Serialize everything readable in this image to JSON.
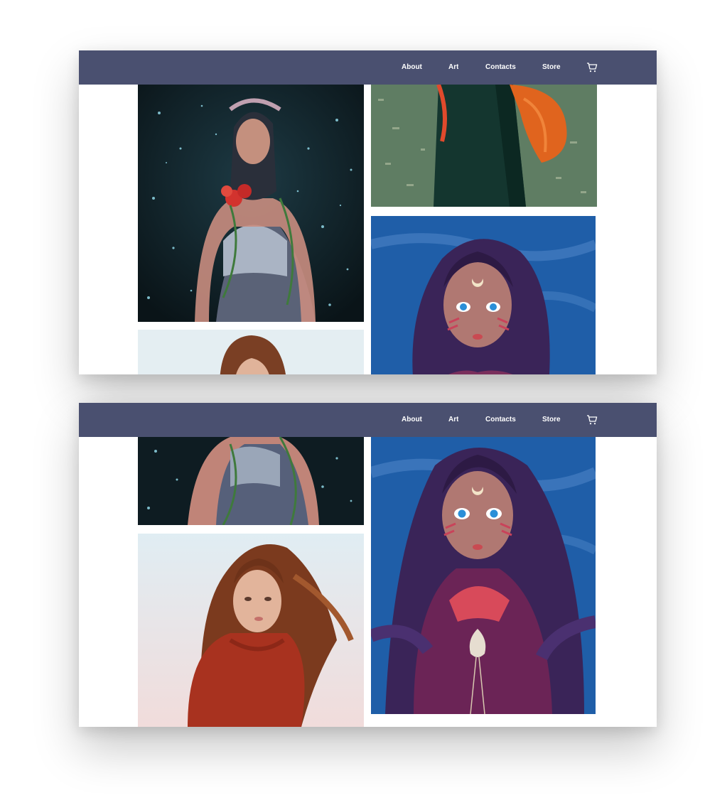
{
  "nav": {
    "links": [
      "About",
      "Art",
      "Contacts",
      "Store"
    ]
  },
  "icons": {
    "cart": "shopping-cart-icon"
  },
  "colors": {
    "nav_bg": "#4a5070",
    "nav_text": "#ffffff",
    "page_bg": "#ffffff"
  },
  "artworks": [
    "girl-with-rose-and-vines",
    "red-haired-girl-in-green-dress",
    "girl-with-crescent-moon-mark",
    "brown-haired-girl-in-red-sweater"
  ]
}
